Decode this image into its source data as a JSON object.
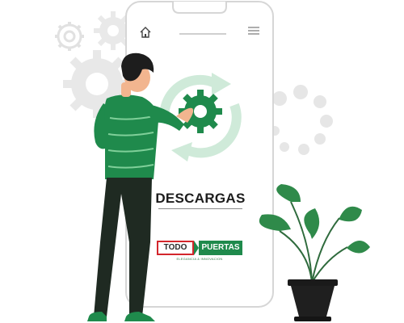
{
  "screen": {
    "title": "DESCARGAS"
  },
  "brand": {
    "name_part1": "TODO",
    "name_part2": "PUERTAS",
    "tagline": "ELEGANCIA & INNOVACION",
    "colors": {
      "primary_green": "#1f8a4c",
      "accent_red": "#d3262c"
    }
  },
  "phone": {
    "nav": {
      "home_icon": "home-icon",
      "menu_icon": "hamburger-menu-icon"
    }
  },
  "illustration": {
    "colors": {
      "shirt": "#1f8a4c",
      "pants": "#1f2a22",
      "hair": "#1d1d1d",
      "gear_gray": "#e6e6e6",
      "plant_green": "#2f8a4a"
    }
  }
}
